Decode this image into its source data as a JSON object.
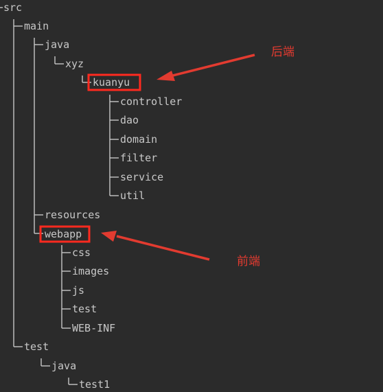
{
  "tree": {
    "root": "src",
    "main": "main",
    "java": "java",
    "xyz": "xyz",
    "kuanyu": "kuanyu",
    "controller": "controller",
    "dao": "dao",
    "domain": "domain",
    "filter": "filter",
    "service": "service",
    "util": "util",
    "resources": "resources",
    "webapp": "webapp",
    "css": "css",
    "images": "images",
    "js": "js",
    "test_web": "test",
    "web_inf": "WEB-INF",
    "test": "test",
    "test_java": "java",
    "test1": "test1"
  },
  "annotations": {
    "backend": "后端",
    "frontend": "前端",
    "color": "#e23b30"
  },
  "colors": {
    "background": "#2b2b2b",
    "text": "#c8c8c8",
    "lines": "#c8c8c8",
    "highlight": "#ff2a1f"
  }
}
